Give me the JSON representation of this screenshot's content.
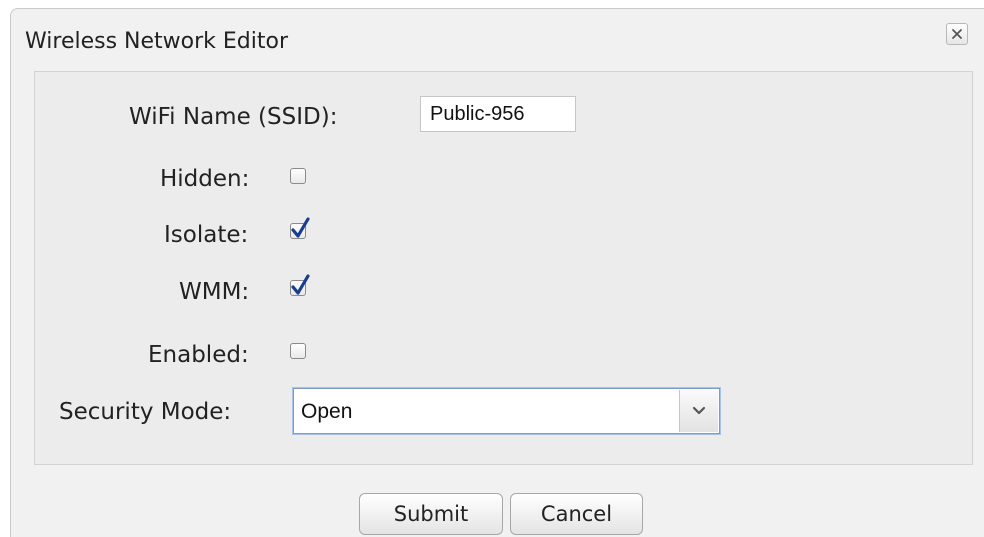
{
  "dialog": {
    "title": "Wireless Network Editor",
    "close_icon": "close-icon"
  },
  "form": {
    "ssid_label": "WiFi Name (SSID):",
    "ssid_value": "Public-956",
    "hidden_label": "Hidden:",
    "hidden_checked": false,
    "isolate_label": "Isolate:",
    "isolate_checked": true,
    "wmm_label": "WMM:",
    "wmm_checked": true,
    "enabled_label": "Enabled:",
    "enabled_checked": false,
    "security_label": "Security Mode:",
    "security_value": "Open",
    "security_arrow_icon": "chevron-down-icon"
  },
  "actions": {
    "submit_label": "Submit",
    "cancel_label": "Cancel"
  },
  "colors": {
    "check_mark": "#1a3d8f",
    "select_border": "#7a9cc6"
  }
}
